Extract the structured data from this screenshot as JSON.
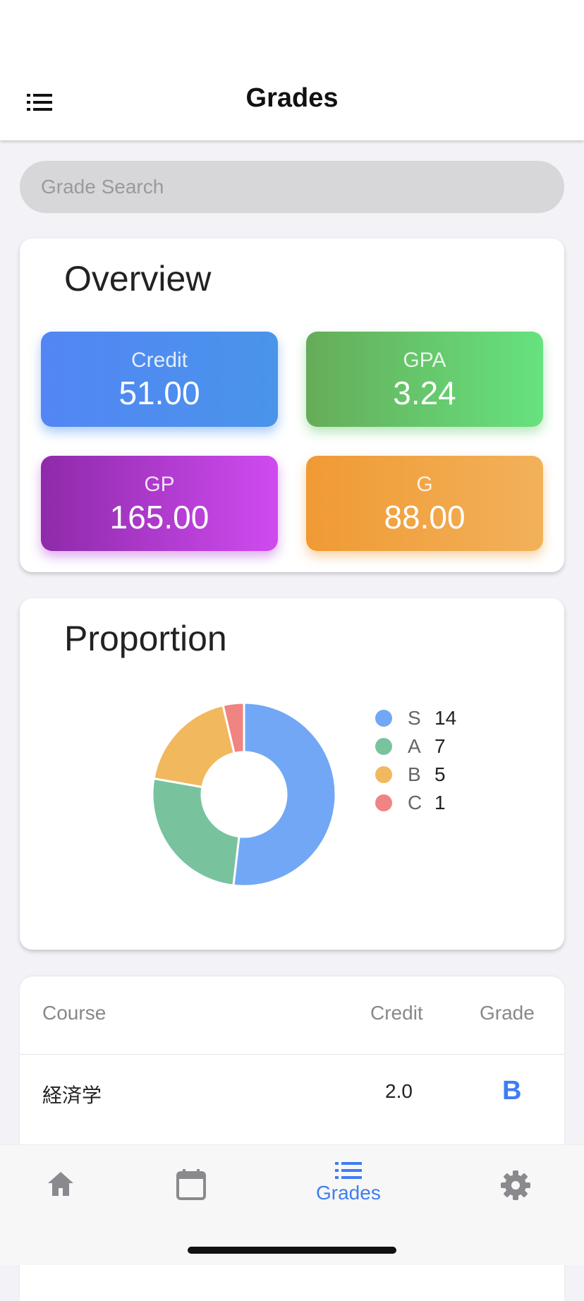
{
  "header": {
    "title": "Grades",
    "menu_icon": "list-icon"
  },
  "search": {
    "placeholder": "Grade Search",
    "value": ""
  },
  "overview": {
    "title": "Overview",
    "stats": [
      {
        "label": "Credit",
        "value": "51.00",
        "color": "#4f8cf2"
      },
      {
        "label": "GPA",
        "value": "3.24",
        "color": "#66c66d"
      },
      {
        "label": "GP",
        "value": "165.00",
        "color": "#b03ed4"
      },
      {
        "label": "G",
        "value": "88.00",
        "color": "#f1a442"
      }
    ]
  },
  "proportion": {
    "title": "Proportion",
    "chart_data": {
      "type": "pie",
      "categories": [
        "S",
        "A",
        "B",
        "C"
      ],
      "values": [
        14,
        7,
        5,
        1
      ],
      "colors": [
        "#72a7f5",
        "#78c39e",
        "#f2b85e",
        "#ef8482"
      ],
      "legend_position": "right",
      "donut": true
    }
  },
  "table": {
    "columns": [
      "Course",
      "Credit",
      "Grade"
    ],
    "rows": [
      {
        "course": "経済学",
        "credit": "2.0",
        "grade": "B"
      }
    ]
  },
  "tabbar": {
    "items": [
      {
        "icon": "home-icon",
        "label": ""
      },
      {
        "icon": "calendar-icon",
        "label": ""
      },
      {
        "icon": "list-icon",
        "label": "Grades",
        "active": true
      },
      {
        "icon": "gear-icon",
        "label": ""
      }
    ],
    "active_color": "#3f7df2",
    "inactive_color": "#8a8a8e"
  }
}
